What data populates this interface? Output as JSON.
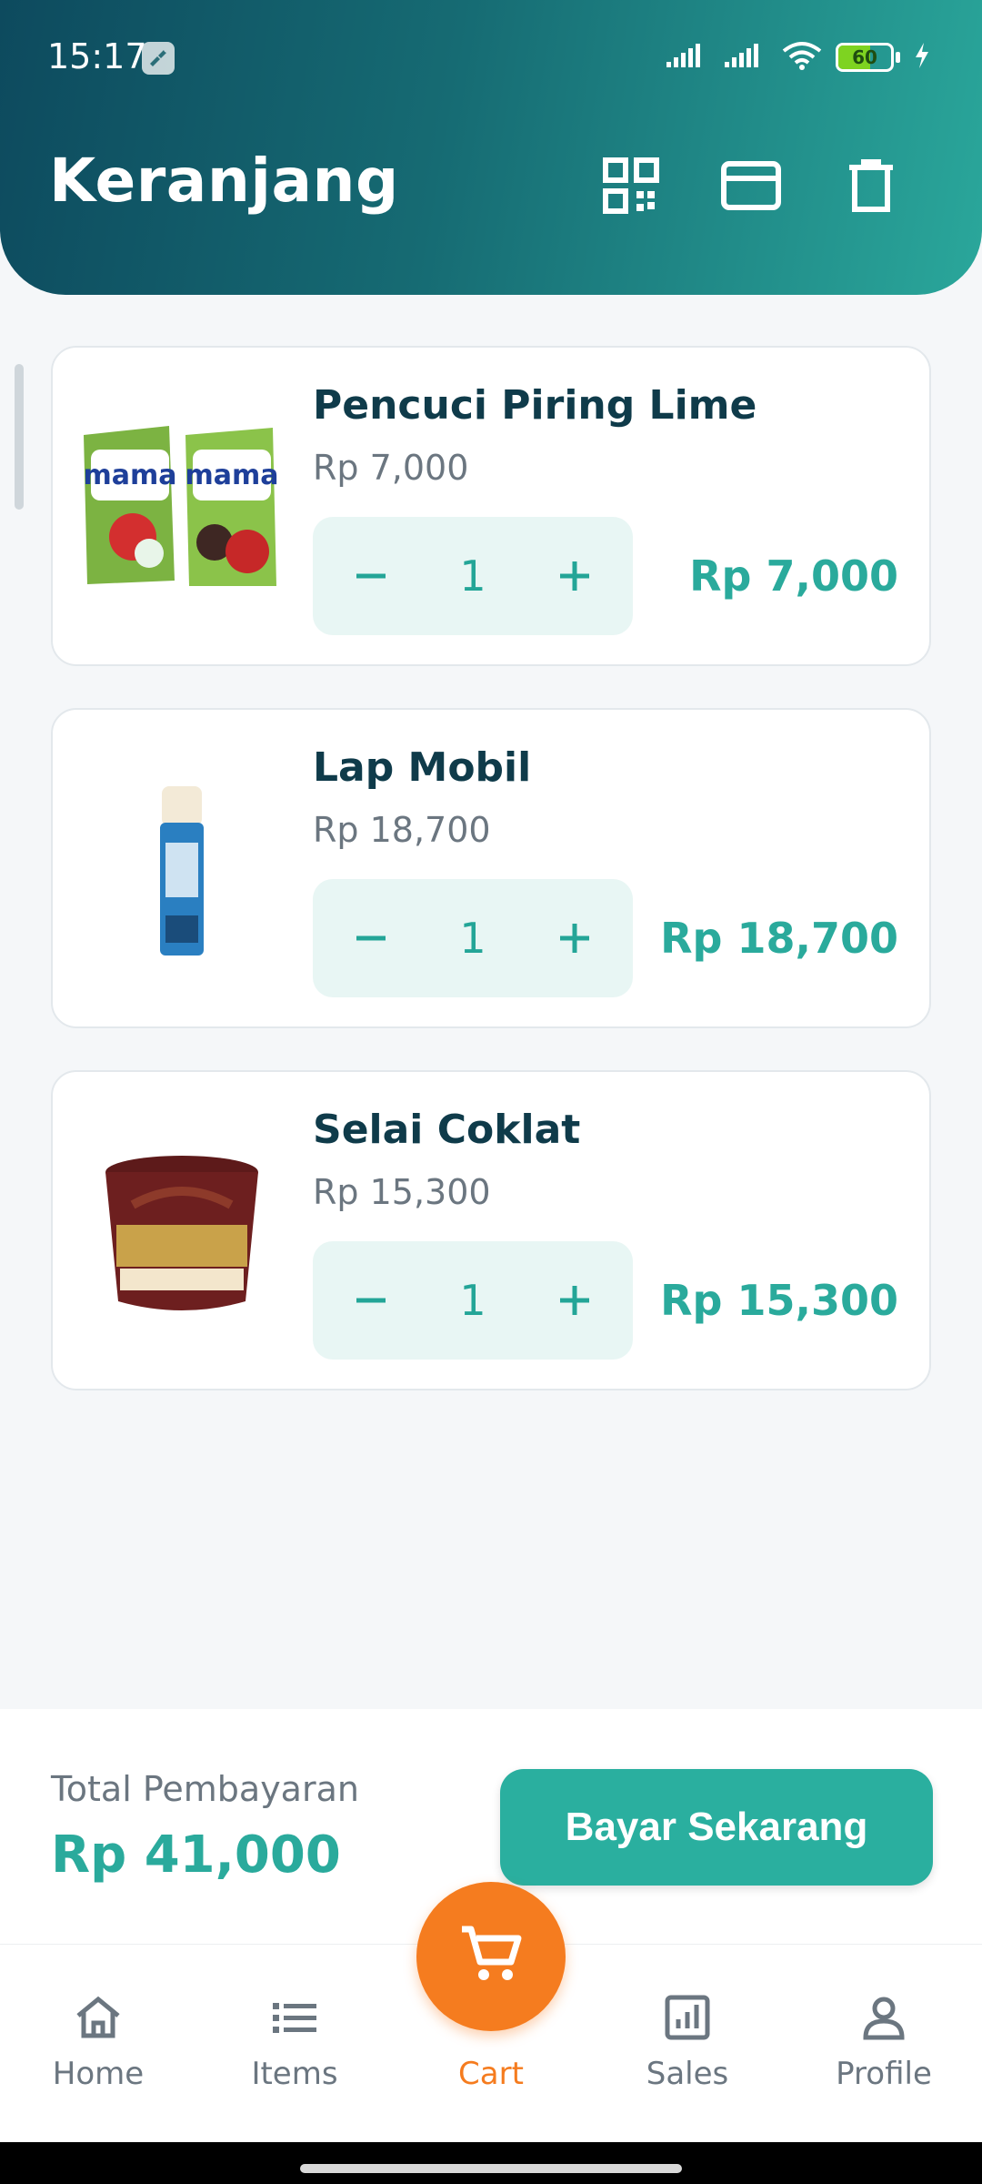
{
  "status_bar": {
    "time": "15:17",
    "battery": "60",
    "battery_level": 0.6
  },
  "header": {
    "title": "Keranjang",
    "icons": [
      "qr-code-icon",
      "credit-card-icon",
      "trash-icon"
    ]
  },
  "colors": {
    "accent": "#2aaa9c",
    "header_dark": "#0d4a5e",
    "cart_orange": "#f57c1f",
    "title_text": "#0f3b4a"
  },
  "cart": {
    "items": [
      {
        "name": "Pencuci Piring Lime",
        "price": "Rp 7,000",
        "qty": "1",
        "total": "Rp 7,000"
      },
      {
        "name": "Lap Mobil",
        "price": "Rp 18,700",
        "qty": "1",
        "total": "Rp 18,700"
      },
      {
        "name": "Selai Coklat",
        "price": "Rp 15,300",
        "qty": "1",
        "total": "Rp 15,300"
      }
    ]
  },
  "summary": {
    "total_label": "Total Pembayaran",
    "total_value": "Rp 41,000",
    "pay_label": "Bayar Sekarang"
  },
  "nav": {
    "items": [
      {
        "label": "Home",
        "icon": "home-icon"
      },
      {
        "label": "Items",
        "icon": "list-icon"
      },
      {
        "label": "Cart",
        "icon": "cart-icon",
        "active": true
      },
      {
        "label": "Sales",
        "icon": "bar-chart-icon"
      },
      {
        "label": "Profile",
        "icon": "person-icon"
      }
    ]
  }
}
